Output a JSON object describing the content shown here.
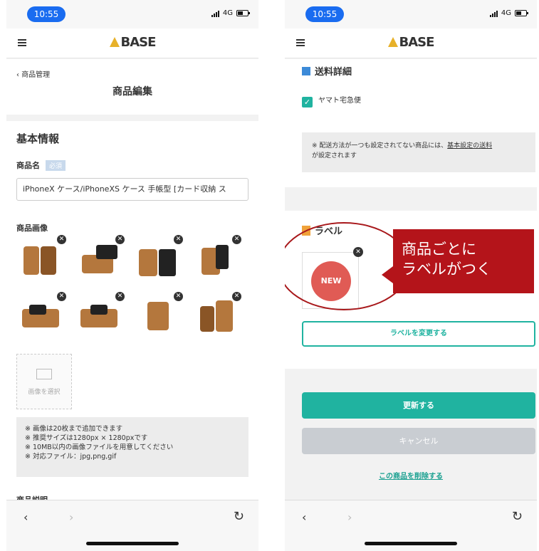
{
  "status": {
    "time": "10:55",
    "network": "4G"
  },
  "header": {
    "logo": "BASE"
  },
  "left": {
    "breadcrumb": "商品管理",
    "title": "商品編集",
    "section_basic": "基本情報",
    "name_label": "商品名",
    "required_badge": "必須",
    "name_value": "iPhoneX ケース/iPhoneXS ケース 手帳型 [カード収納 ス",
    "images_label": "商品画像",
    "select_image": "画像を選択",
    "notes": [
      "※ 画像は20枚まで追加できます",
      "※ 推奨サイズは1280px × 1280pxです",
      "※ 10MB以内の画像ファイルを用意してください",
      "※ 対応ファイル：jpg,png,gif"
    ],
    "cut_label": "商品説明"
  },
  "right": {
    "shipping_title": "送料詳細",
    "yamato": "ヤマト宅急便",
    "ship_note_1": "※ 配送方法が一つも設定されてない商品には、",
    "ship_note_link": "基本設定の送料",
    "ship_note_2": "が設定されます",
    "label_title": "ラベル",
    "new_badge": "NEW",
    "callout_line1": "商品ごとに",
    "callout_line2": "ラベルがつく",
    "change_label_button": "ラベルを変更する",
    "update_button": "更新する",
    "cancel_button": "キャンセル",
    "delete_link": "この商品を削除する"
  },
  "icons": {
    "menu": "hamburger-icon",
    "back": "chevron-left-icon",
    "forward": "chevron-right-icon",
    "reload": "reload-icon",
    "close": "close-icon"
  },
  "colors": {
    "accent": "#20b3a0",
    "callout": "#b4141a",
    "time_pill": "#1a6cf0",
    "new_badge": "#e05b55"
  }
}
